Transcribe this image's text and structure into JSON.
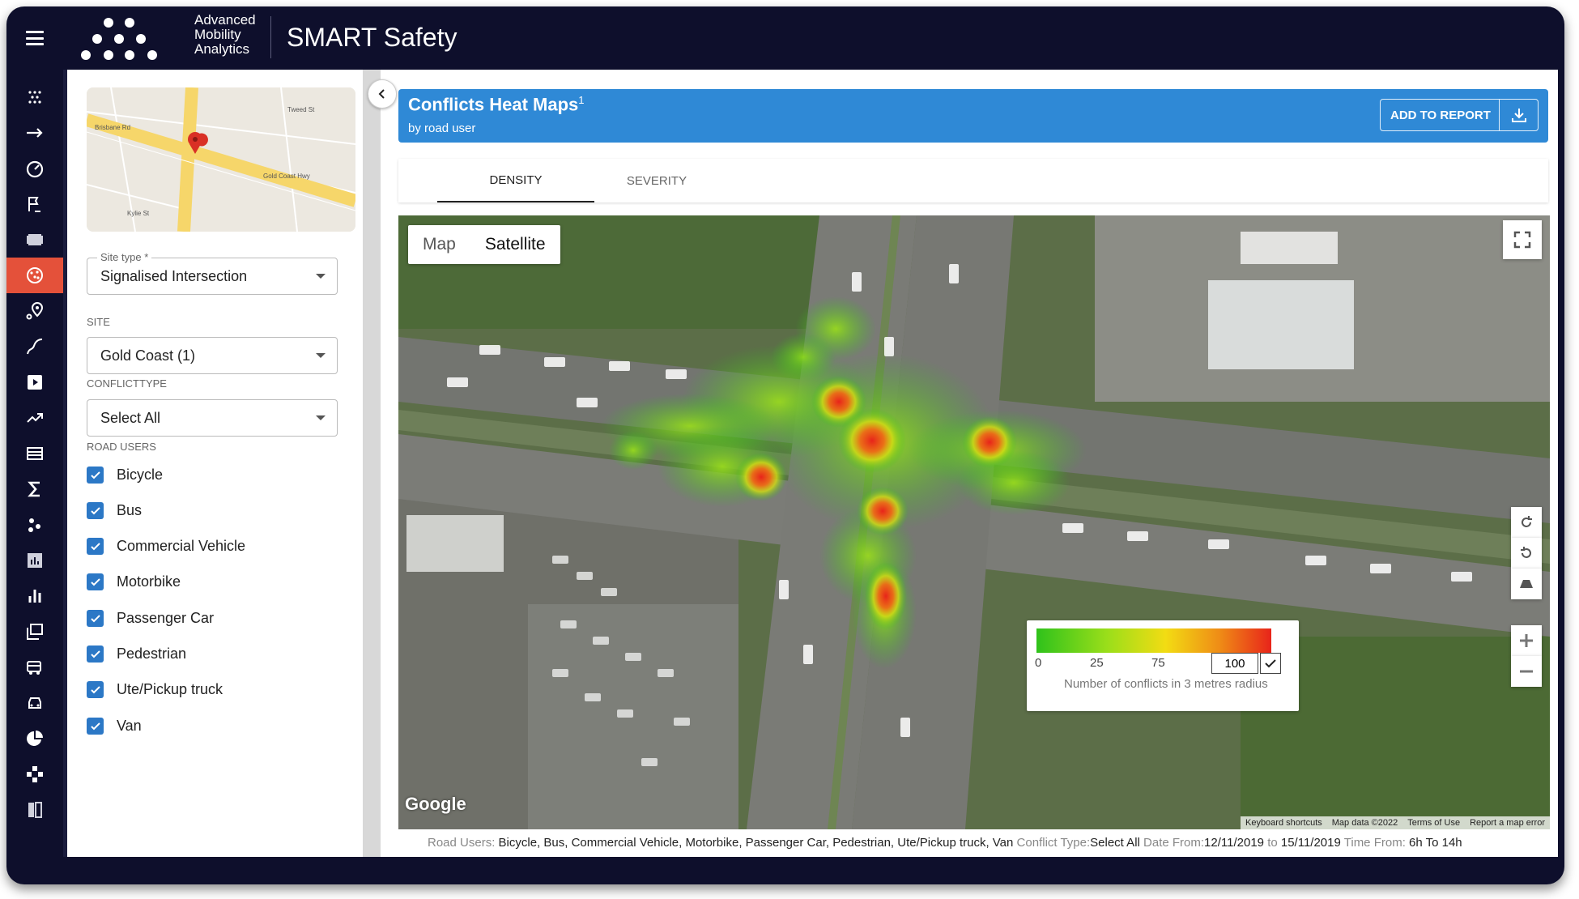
{
  "app": {
    "brand_lines": [
      "Advanced",
      "Mobility",
      "Analytics"
    ],
    "title": "SMART Safety"
  },
  "nav_icons": [
    "cluster-icon",
    "arrow-right-icon",
    "speedometer-icon",
    "route-flag-icon",
    "film-icon",
    "conflicts-icon",
    "map-pin-icon",
    "curve-icon",
    "video-icon",
    "trend-icon",
    "list-icon",
    "sigma-icon",
    "dots-icon",
    "bar-chart-box-icon",
    "bar-chart-icon",
    "layers-icon",
    "bus-icon",
    "car-icon",
    "pie-chart-icon",
    "network-icon",
    "compare-icon"
  ],
  "filters": {
    "site_type_label": "Site type *",
    "site_type_value": "Signalised Intersection",
    "site_label": "SITE",
    "site_value": "Gold Coast (1)",
    "conflict_type_label": "CONFLICTTYPE",
    "conflict_type_value": "Select All",
    "road_users_label": "ROAD USERS",
    "road_users": [
      {
        "label": "Bicycle",
        "checked": true
      },
      {
        "label": "Bus",
        "checked": true
      },
      {
        "label": "Commercial Vehicle",
        "checked": true
      },
      {
        "label": "Motorbike",
        "checked": true
      },
      {
        "label": "Passenger Car",
        "checked": true
      },
      {
        "label": "Pedestrian",
        "checked": true
      },
      {
        "label": "Ute/Pickup truck",
        "checked": true
      },
      {
        "label": "Van",
        "checked": true
      }
    ],
    "minimap_streets": [
      "Brisbane Rd",
      "Gold Coast Hwy",
      "Kylie St",
      "Tweed St"
    ]
  },
  "report": {
    "title": "Conflicts Heat Maps",
    "superscript": "1",
    "subtitle": "by road user",
    "add_button": "ADD TO REPORT"
  },
  "tabs": [
    {
      "label": "DENSITY",
      "active": true
    },
    {
      "label": "SEVERITY",
      "active": false
    }
  ],
  "map": {
    "type_options": [
      "Map",
      "Satellite"
    ],
    "selected_type": "Satellite",
    "google_label": "Google",
    "legend": {
      "ticks": [
        "0",
        "25",
        "75"
      ],
      "max_value": "100",
      "caption": "Number of conflicts in 3 metres radius",
      "colors": [
        "#2fc21b",
        "#f2dc13",
        "#e8241a"
      ]
    },
    "footer": [
      "Keyboard shortcuts",
      "Map data ©2022",
      "Terms of Use",
      "Report a map error"
    ]
  },
  "summary": {
    "road_users_key": "Road Users:",
    "road_users_val": "Bicycle, Bus, Commercial Vehicle, Motorbike, Passenger Car, Pedestrian, Ute/Pickup truck, Van",
    "conflict_key": "Conflict Type:",
    "conflict_val": "Select All",
    "date_key": "Date From:",
    "date_from": "12/11/2019",
    "to_word": "to",
    "date_to": "15/11/2019",
    "time_key": "Time From:",
    "time_val": "6h To 14h"
  }
}
